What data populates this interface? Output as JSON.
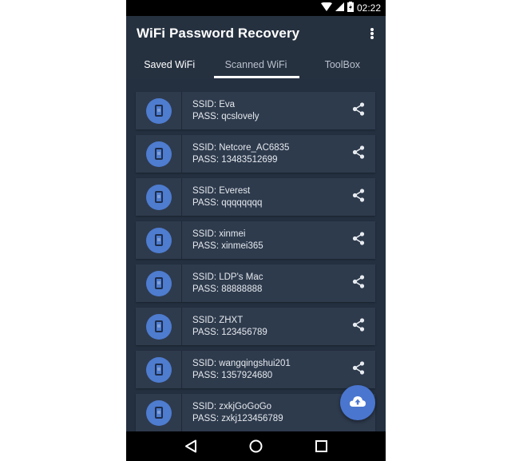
{
  "status_bar": {
    "time": "02:22",
    "icons": [
      "wifi-icon",
      "cell-signal-icon",
      "battery-charging-icon"
    ]
  },
  "app_bar": {
    "title": "WiFi Password Recovery",
    "menu_icon": "more-vert-icon"
  },
  "tabs": [
    {
      "label": "Saved WiFi",
      "active": false
    },
    {
      "label": "Scanned WiFi",
      "active": true
    },
    {
      "label": "ToolBox",
      "active": false
    }
  ],
  "list": {
    "items": [
      {
        "ssid": "SSID: Eva",
        "pass": "PASS: qcslovely"
      },
      {
        "ssid": "SSID: Netcore_AC6835",
        "pass": "PASS: 13483512699"
      },
      {
        "ssid": "SSID: Everest",
        "pass": "PASS: qqqqqqqq"
      },
      {
        "ssid": "SSID: xinmei",
        "pass": "PASS: xinmei365"
      },
      {
        "ssid": "SSID: LDP's Mac",
        "pass": "PASS: 88888888"
      },
      {
        "ssid": "SSID: ZHXT",
        "pass": "PASS: 123456789"
      },
      {
        "ssid": "SSID: wangqingshui201",
        "pass": "PASS: 1357924680"
      },
      {
        "ssid": "SSID: zxkjGoGoGo",
        "pass": "PASS: zxkj123456789"
      }
    ],
    "item_icon": "phone-wifi-icon",
    "action_icon": "share-icon"
  },
  "fab": {
    "icon": "cloud-upload-icon"
  },
  "nav_bar": {
    "buttons": [
      "back-icon",
      "home-icon",
      "recents-icon"
    ]
  },
  "colors": {
    "background": "#263140",
    "card": "#2e3b4d",
    "accent": "#4a76d0",
    "text": "#e5e9ee"
  }
}
